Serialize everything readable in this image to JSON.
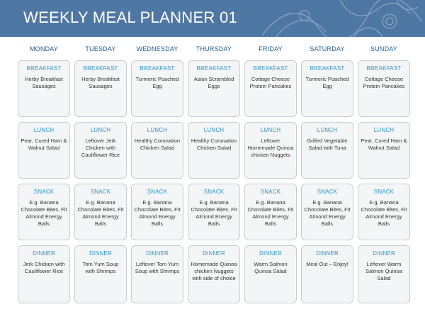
{
  "header": {
    "title": "WEEKLY MEAL PLANNER 01",
    "accent_color": "#4f77a3"
  },
  "days": [
    "MONDAY",
    "TUESDAY",
    "WEDNESDAY",
    "THURSDAY",
    "FRIDAY",
    "SATURDAY",
    "SUNDAY"
  ],
  "meal_labels": {
    "breakfast": "BREAKFAST",
    "lunch": "LUNCH",
    "snack": "SNACK",
    "dinner": "DINNER"
  },
  "plan": {
    "breakfast": [
      "Herby Breakfast Sausages",
      "Herby Breakfast Sausages",
      "Turmeric Poached Egg",
      "Asian Scrambled Eggs",
      "Cottage Cheese Protein Pancakes",
      "Turmeric Poached Egg",
      "Cottage Cheese Protein Pancakes"
    ],
    "lunch": [
      "Pear, Cured Ham & Walnut Salad",
      "Leftover Jerk Chicken with Cauliflower Rice",
      "Healthy Coronation Chicken Salad",
      "Healthy Coronation Chicken Salad",
      "Leftover Homemade Quinoa chicken Nuggets",
      "Grilled Vegetable Salad with Tuna",
      "Pear, Cured Ham & Walnut Salad"
    ],
    "snack": [
      "E.g. Banana Chocolate Bites, Fit Almond Energy Balls",
      "E.g. Banana Chocolate Bites, Fit Almond Energy Balls",
      "E.g. Banana Chocolate Bites, Fit Almond Energy Balls",
      "E.g. Banana Chocolate Bites, Fit Almond Energy Balls",
      "E.g. Banana Chocolate Bites, Fit Almond Energy Balls",
      "E.g. Banana Chocolate Bites, Fit Almond Energy Balls",
      "E.g. Banana Chocolate Bites, Fit Almond Energy Balls"
    ],
    "dinner": [
      "Jerk Chicken with Cauliflower Rice",
      "Tom Yum Soup with Shrimps",
      "Leftover Tom Yum Soup with Shrimps",
      "Homemade Quinoa chicken Nuggets with side of choice",
      "Warm Salmon Quinoa Salad",
      "Meal Out – Enjoy!",
      "Leftover Warm Salmon Quinoa Salad"
    ]
  }
}
